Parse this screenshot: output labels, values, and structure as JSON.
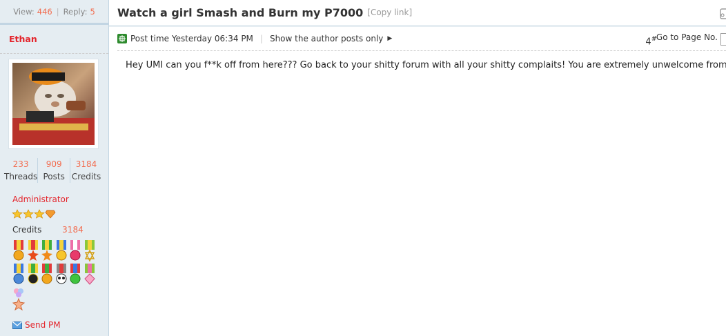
{
  "thread_stats": {
    "view_label": "View:",
    "view_count": "446",
    "reply_label": "Reply:",
    "reply_count": "5"
  },
  "author": {
    "name": "Ethan",
    "threads": "233",
    "threads_label": "Threads",
    "posts": "909",
    "posts_label": "Posts",
    "credits": "3184",
    "credits_label": "Credits",
    "group": "Administrator",
    "credits_row_label": "Credits",
    "credits_row_value": "3184",
    "send_pm": "Send PM"
  },
  "thread": {
    "title": "Watch a girl Smash and Burn my P7000",
    "copy_link": "[Copy link]"
  },
  "post": {
    "time": "Post time Yesterday 06:34 PM",
    "author_only": "Show the author posts only",
    "floor": "4",
    "floor_mark": "#",
    "goto_page": "Go to Page No.",
    "body": "Hey UMI  can you f**k off from here??? Go back to your shitty forum with all your shitty complaits! You are extremely unwelcome from here"
  },
  "colors": {
    "accent_red": "#e4242b",
    "number_orange": "#f26c4f",
    "sidebar_bg": "#e5edf2",
    "border_blue": "#c2d5e3"
  },
  "icons": [
    "envelope-icon",
    "print-icon",
    "post-meta-icon",
    "triangle-right-icon",
    "star-rank-icon",
    "medal-icon"
  ]
}
